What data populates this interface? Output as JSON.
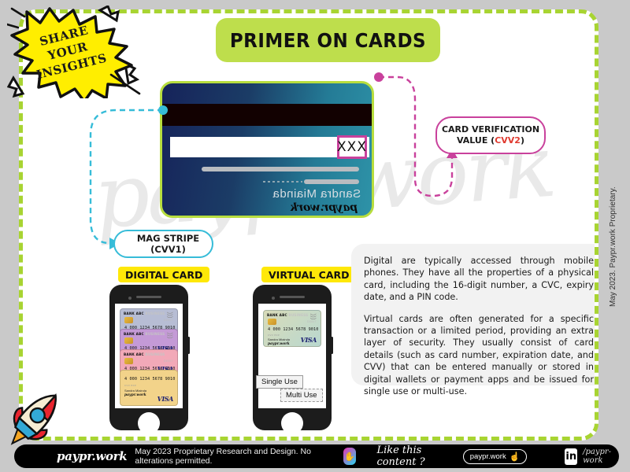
{
  "page": {
    "title": "PRIMER ON CARDS",
    "accent_green": "#bede4c",
    "accent_yellow": "#ffe808",
    "accent_pink": "#c9419c",
    "accent_cyan": "#36bcd8",
    "watermark": "paypr.work"
  },
  "starburst": {
    "line1": "SHARE YOUR",
    "line2": "INSIGHTS",
    "fill": "#ffee00"
  },
  "card": {
    "cvv_box_value": "XXX",
    "holder_name": "Sandra Miainda",
    "brand_script": "paypr.work"
  },
  "callouts": {
    "cvv2": {
      "line1": "CARD VERIFICATION",
      "line2_prefix": "VALUE (",
      "highlight": "CVV2",
      "line2_suffix": ")"
    },
    "magstripe": {
      "label": "MAG STRIPE (CVV1)"
    }
  },
  "badges": {
    "digital": "DIGITAL CARD",
    "virtual": "VIRTUAL CARD"
  },
  "mini_card": {
    "bank": "BANK ABC",
    "business": "BUSINESS",
    "debit": "DEBIT",
    "number": "4 000  1234  5678  9010",
    "small_labels": "CVV      EXP",
    "name": "Sandra Miainda",
    "brand": "paypr.work",
    "network": "VISA"
  },
  "virtual_use": {
    "single": "Single Use",
    "multi": "Multi Use"
  },
  "info_panel": {
    "paragraph1": "Digital are typically accessed through mobile phones. They have all the properties of a physical card, including the 16-digit number, a CVC, expiry date, and a PIN code.",
    "paragraph2": "Virtual cards are often generated for a specific transaction or a limited period, providing an extra layer of security. They usually consist of card details (such as card number, expiration date, and CVV) that can be entered manually or stored in digital wallets or payment apps and be issued for single use or multi-use."
  },
  "side_text": "May 2023. Paypr.work Proprietary.",
  "footer": {
    "brand": "paypr.work",
    "copyright": "May 2023 Proprietary Research and Design. No alterations permitted.",
    "like_text": "Like this content ?",
    "cta_label": "paypr.work",
    "linkedin_mark": "in",
    "linkedin_handle": "/paypr-work"
  }
}
